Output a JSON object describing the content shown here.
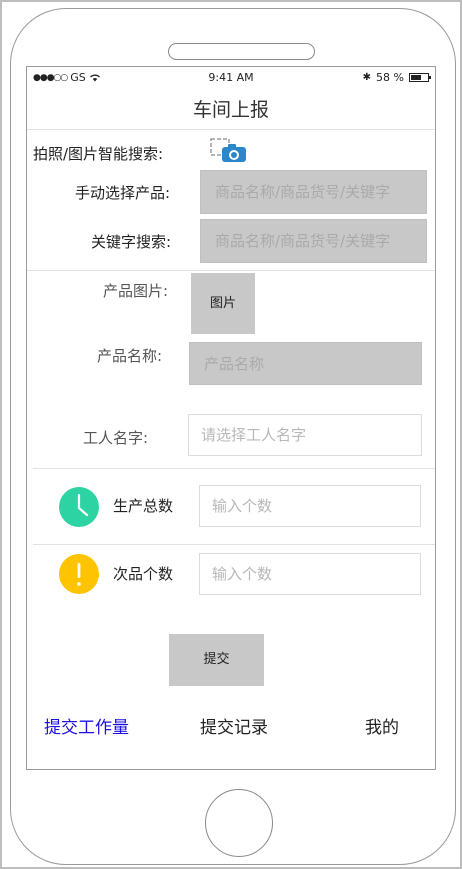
{
  "status_bar": {
    "carrier": "GS",
    "time": "9:41 AM",
    "battery": "58 %"
  },
  "page": {
    "title": "车间上报"
  },
  "search": {
    "photo_label": "拍照/图片智能搜索:",
    "manual_label": "手动选择产品:",
    "manual_placeholder": "商品名称/商品货号/关键字",
    "keyword_label": "关键字搜索:",
    "keyword_placeholder": "商品名称/商品货号/关键字"
  },
  "product": {
    "image_label": "产品图片:",
    "image_button": "图片",
    "name_label": "产品名称:",
    "name_placeholder": "产品名称",
    "worker_label": "工人名字:",
    "worker_placeholder": "请选择工人名字"
  },
  "counts": {
    "total_label": "生产总数",
    "total_placeholder": "输入个数",
    "defect_label": "次品个数",
    "defect_placeholder": "输入个数"
  },
  "actions": {
    "submit": "提交"
  },
  "tabs": [
    {
      "label": "提交工作量",
      "active": true
    },
    {
      "label": "提交记录",
      "active": false
    },
    {
      "label": "我的",
      "active": false
    }
  ],
  "colors": {
    "accent": "#1d10e6",
    "clock": "#2ed3a4",
    "warning": "#ffc400",
    "camera": "#2b87c8"
  }
}
